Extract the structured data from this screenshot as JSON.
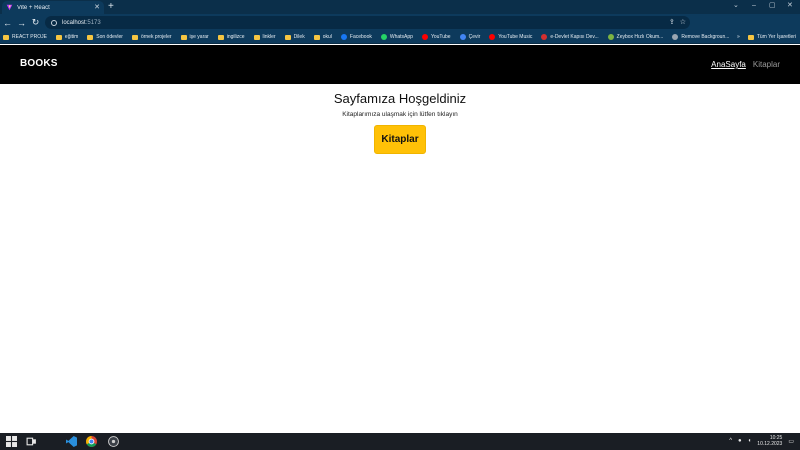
{
  "browser": {
    "tab_title": "Vite + React",
    "new_tab": "+",
    "window_controls": [
      "⌄",
      "–",
      "▢",
      "✕"
    ],
    "url_host": "localhost",
    "url_port": ":5173",
    "bookmarks": [
      {
        "label": "REACT PROJE",
        "icon": "folder-icon"
      },
      {
        "label": "eğitim",
        "icon": "folder-icon"
      },
      {
        "label": "Son ödevler",
        "icon": "folder-icon"
      },
      {
        "label": "örnek projeler",
        "icon": "folder-icon"
      },
      {
        "label": "işe yarar",
        "icon": "folder-icon"
      },
      {
        "label": "ingilizce",
        "icon": "folder-icon"
      },
      {
        "label": "linkler",
        "icon": "folder-icon"
      },
      {
        "label": "Dilek",
        "icon": "folder-icon"
      },
      {
        "label": "okul",
        "icon": "folder-icon"
      },
      {
        "label": "Facebook",
        "icon": "facebook-icon"
      },
      {
        "label": "WhatsApp",
        "icon": "whatsapp-icon"
      },
      {
        "label": "YouTube",
        "icon": "youtube-icon"
      },
      {
        "label": "Çevir",
        "icon": "translate-icon"
      },
      {
        "label": "YouTube Music",
        "icon": "youtube-music-icon"
      },
      {
        "label": "e-Devlet Kapısı Dev...",
        "icon": "edevlet-icon"
      },
      {
        "label": "Zeybox Hızlı Okum...",
        "icon": "zeybox-icon"
      },
      {
        "label": "Remove Backgroun...",
        "icon": "remove-bg-icon"
      }
    ],
    "all_bookmarks": "Tüm Yer İşaretleri",
    "more_bookmarks": "»"
  },
  "app": {
    "brand": "BOOKS",
    "nav_home": "AnaSayfa",
    "nav_books": "Kitaplar",
    "heading": "Sayfamıza Hoşgeldiniz",
    "subtext": "Kitaplarımıza ulaşmak için lütfen tıklayın",
    "cta": "Kitaplar"
  },
  "taskbar": {
    "time": "10:25",
    "date": "10.12.2023",
    "tray_chevron": "^"
  },
  "colors": {
    "browser_chrome": "#0d3a5c",
    "navbar": "#000000",
    "button": "#ffc107",
    "taskbar": "#1a1e24"
  }
}
